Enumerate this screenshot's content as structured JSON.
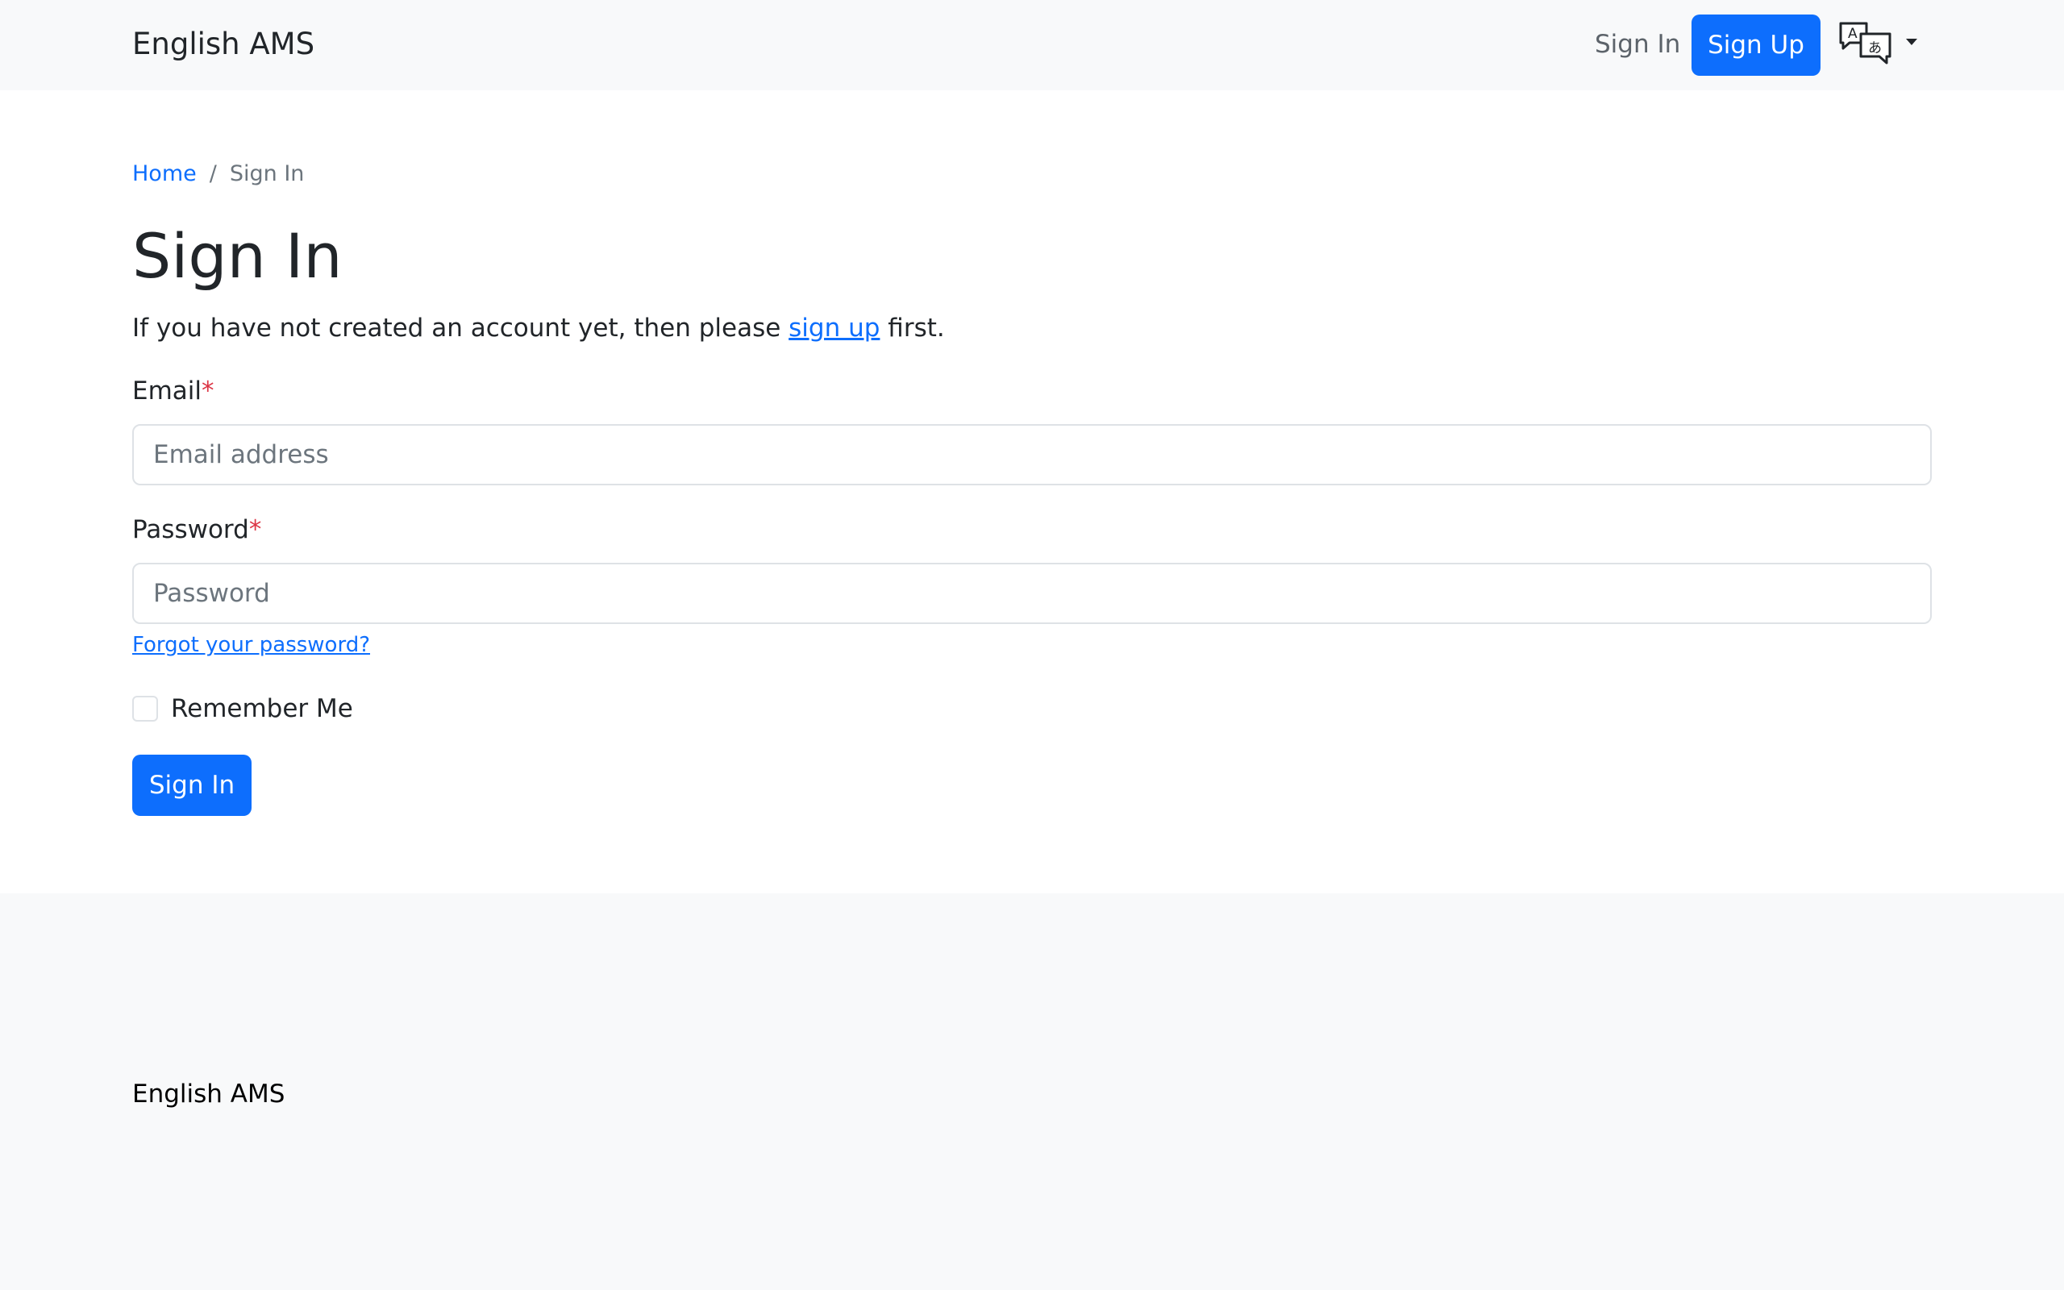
{
  "navbar": {
    "brand": "English AMS",
    "sign_in_link": "Sign In",
    "sign_up_button": "Sign Up",
    "language_icon": "translate-icon"
  },
  "breadcrumb": {
    "home": "Home",
    "separator": "/",
    "current": "Sign In"
  },
  "main": {
    "title": "Sign In",
    "intro_prefix": "If you have not created an account yet, then please ",
    "intro_link": "sign up",
    "intro_suffix": " first.",
    "email_label": "Email",
    "email_placeholder": "Email address",
    "password_label": "Password",
    "password_placeholder": "Password",
    "required_mark": "*",
    "forgot_link": "Forgot your password?",
    "remember_label": "Remember Me",
    "submit_button": "Sign In"
  },
  "footer": {
    "brand": "English AMS"
  },
  "colors": {
    "primary": "#0d6efd",
    "required": "#dc3545",
    "navbar_bg": "#f8f9fa"
  }
}
